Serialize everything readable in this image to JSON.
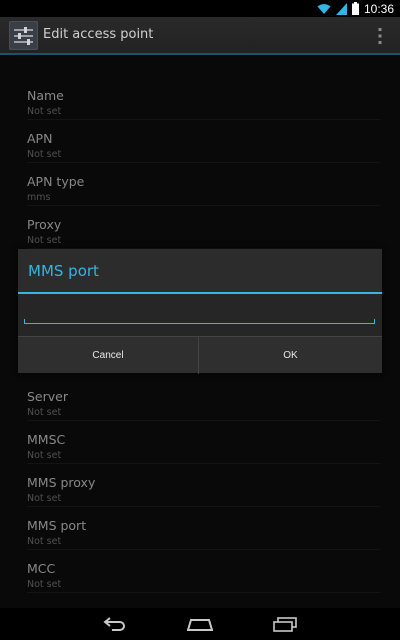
{
  "status_bar": {
    "time": "10:36"
  },
  "action_bar": {
    "title": "Edit access point"
  },
  "preferences_top": [
    {
      "title": "Name",
      "summary": "Not set"
    },
    {
      "title": "APN",
      "summary": "Not set"
    },
    {
      "title": "APN type",
      "summary": "mms"
    },
    {
      "title": "Proxy",
      "summary": "Not set"
    }
  ],
  "preferences_bottom": [
    {
      "title": "Server",
      "summary": "Not set"
    },
    {
      "title": "MMSC",
      "summary": "Not set"
    },
    {
      "title": "MMS proxy",
      "summary": "Not set"
    },
    {
      "title": "MMS port",
      "summary": "Not set"
    },
    {
      "title": "MCC",
      "summary": "Not set"
    }
  ],
  "dialog": {
    "title": "MMS port",
    "input_value": "",
    "cancel_label": "Cancel",
    "ok_label": "OK"
  },
  "colors": {
    "accent": "#33b5e5",
    "action_bar_divider": "#2a7fa1"
  }
}
